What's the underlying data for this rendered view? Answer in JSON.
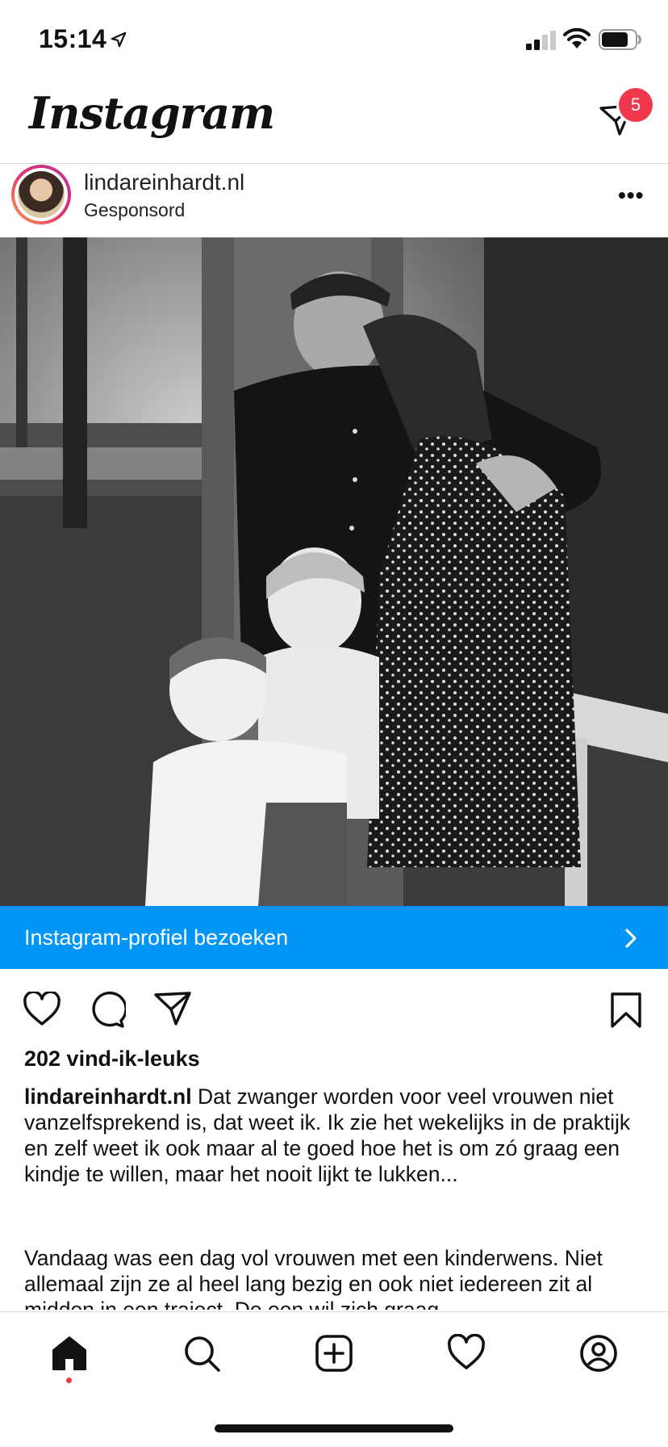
{
  "status_bar": {
    "time": "15:14",
    "battery_level": 0.8
  },
  "header": {
    "logo": "Instagram",
    "dm_badge": "5"
  },
  "post": {
    "username": "lindareinhardt.nl",
    "sponsored_label": "Gesponsord",
    "cta_label": "Instagram-profiel bezoeken",
    "likes": "202 vind-ik-leuks",
    "caption_username": "lindareinhardt.nl",
    "caption_text": " Dat zwanger worden voor veel vrouwen niet vanzelfsprekend is, dat weet ik. Ik zie het wekelijks in de praktijk en zelf weet ik ook maar al te goed hoe het is om zó graag een kindje te willen, maar het nooit lijkt te lukken...",
    "caption_more": "Vandaag was een dag vol vrouwen met een kinderwens. Niet allemaal zijn ze al heel lang bezig en ook niet iedereen zit al midden in een traject. De een wil zich graag"
  },
  "tab_bar": {
    "items": [
      "home",
      "search",
      "new-post",
      "activity",
      "profile"
    ],
    "active": "home"
  },
  "colors": {
    "accent": "#0095f6",
    "badge": "#f1374c"
  }
}
